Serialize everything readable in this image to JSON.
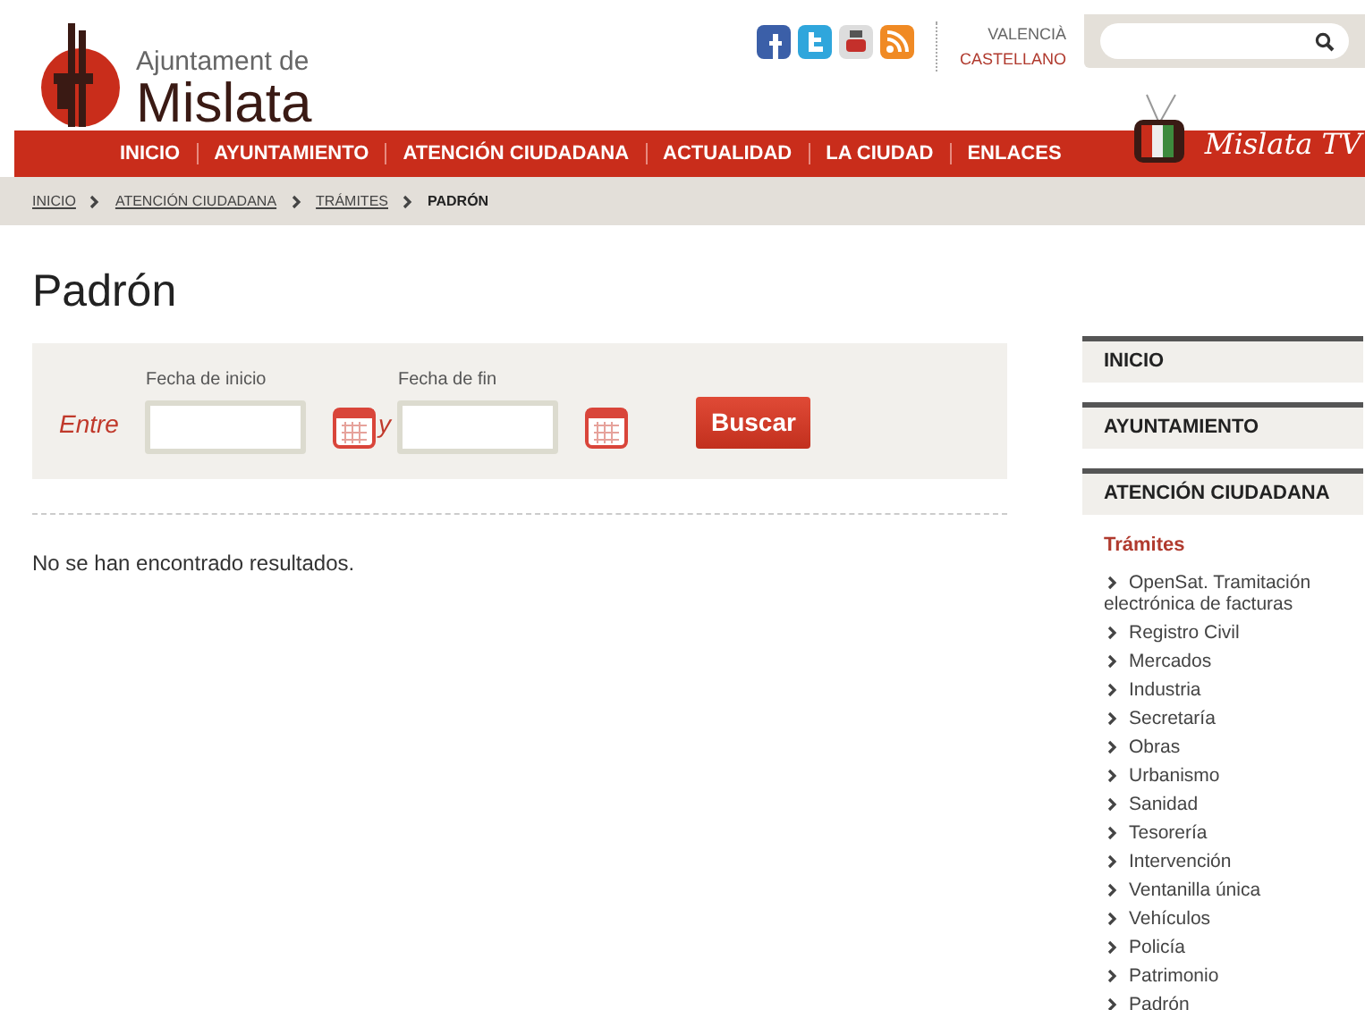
{
  "header": {
    "logo_small": "Ajuntament de",
    "logo_big": "Mislata",
    "languages": [
      {
        "label": "VALENCIÀ",
        "selected": false
      },
      {
        "label": "CASTELLANO",
        "selected": true
      }
    ],
    "tv_label": "Mislata TV"
  },
  "nav": [
    "INICIO",
    "AYUNTAMIENTO",
    "ATENCIÓN CIUDADANA",
    "ACTUALIDAD",
    "LA CIUDAD",
    "ENLACES"
  ],
  "breadcrumb": [
    {
      "label": "INICIO",
      "current": false
    },
    {
      "label": "ATENCIÓN CIUDADANA",
      "current": false
    },
    {
      "label": "TRÁMITES",
      "current": false
    },
    {
      "label": "PADRÓN",
      "current": true
    }
  ],
  "page_title": "Padrón",
  "filter": {
    "prefix": "Entre",
    "start_label": "Fecha de inicio",
    "joiner": "y",
    "end_label": "Fecha de fin",
    "button": "Buscar"
  },
  "result_message": "No se han encontrado resultados.",
  "sidebar": {
    "sections": [
      {
        "label": "INICIO"
      },
      {
        "label": "AYUNTAMIENTO"
      },
      {
        "label": "ATENCIÓN CIUDADANA",
        "subsection": {
          "title": "Trámites",
          "items": [
            "OpenSat. Tramitación electrónica de facturas",
            "Registro Civil",
            "Mercados",
            "Industria",
            "Secretaría",
            "Obras",
            "Urbanismo",
            "Sanidad",
            "Tesorería",
            "Intervención",
            "Ventanilla única",
            "Vehículos",
            "Policía",
            "Patrimonio",
            "Padrón"
          ]
        }
      }
    ]
  }
}
